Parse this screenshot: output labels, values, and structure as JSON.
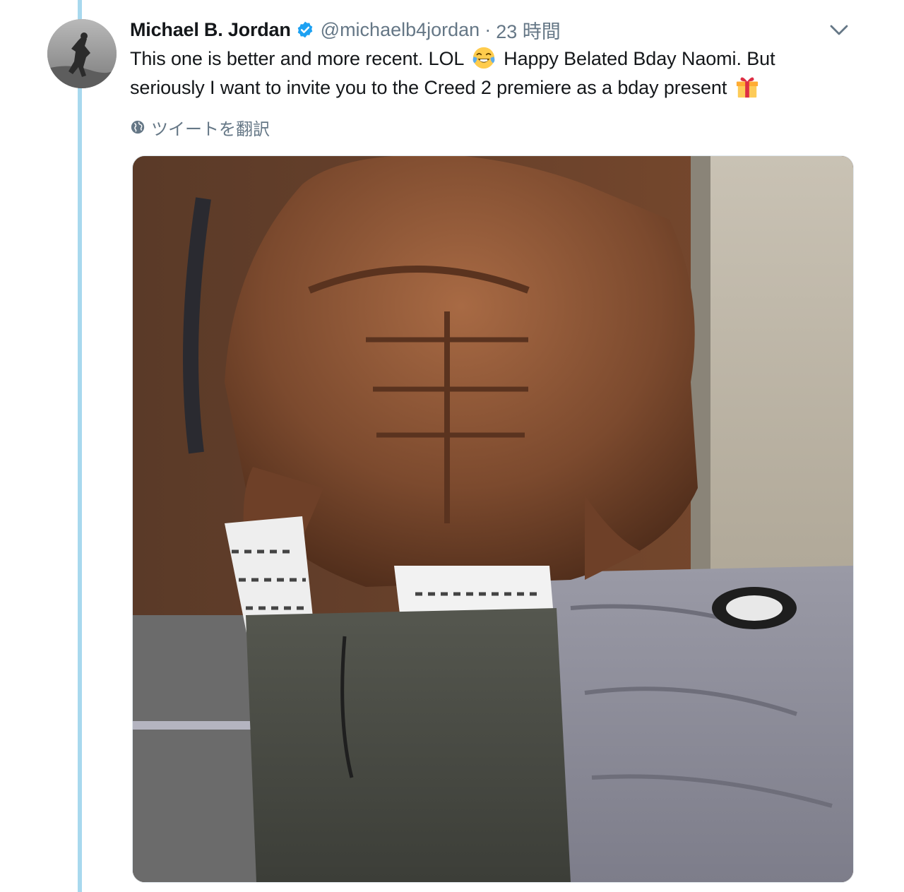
{
  "tweet": {
    "display_name": "Michael B. Jordan",
    "handle": "@michaelb4jordan",
    "separator": "·",
    "timestamp": "23 時間",
    "text_line1_a": "This one is better and more recent. LOL",
    "text_line1_b": "Happy Belated Bday Naomi. But",
    "text_line2": "seriously I want to invite you to the Creed 2 premiere as a bday present",
    "emoji_1": "laughing-crying-emoji",
    "emoji_2": "gift-emoji",
    "translate_label": "ツイートを翻訳"
  },
  "icons": {
    "verified": "verified-badge-icon",
    "caret": "chevron-down-icon",
    "globe": "globe-icon"
  },
  "colors": {
    "accent": "#1da1f2",
    "thread_line": "#a8d9ee",
    "secondary_text": "#657786",
    "primary_text": "#14171a"
  }
}
